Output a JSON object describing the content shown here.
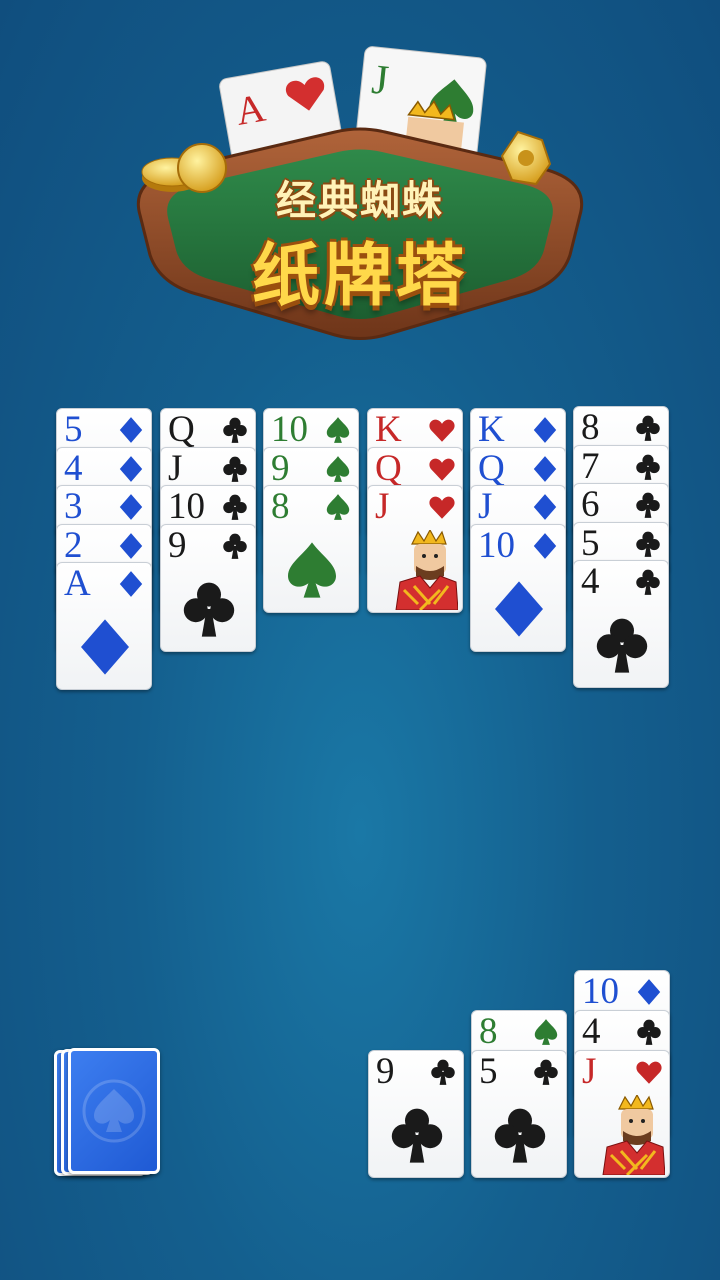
{
  "title": {
    "line1": "经典蜘蛛",
    "line2": "纸牌塔"
  },
  "logo_cards": [
    {
      "rank": "A",
      "suit": "heart"
    },
    {
      "rank": "J",
      "suit": "spade"
    }
  ],
  "colors": {
    "blue": "#1f4fd1",
    "black": "#1a1a1a",
    "green": "#2e7d32",
    "red": "#c62828",
    "table": "#145f8e"
  },
  "tableau": [
    {
      "cards": [
        {
          "rank": "5",
          "suit": "diamond"
        },
        {
          "rank": "4",
          "suit": "diamond"
        },
        {
          "rank": "3",
          "suit": "diamond"
        },
        {
          "rank": "2",
          "suit": "diamond"
        },
        {
          "rank": "A",
          "suit": "diamond"
        }
      ]
    },
    {
      "cards": [
        {
          "rank": "Q",
          "suit": "club"
        },
        {
          "rank": "J",
          "suit": "club"
        },
        {
          "rank": "10",
          "suit": "club"
        },
        {
          "rank": "9",
          "suit": "club"
        }
      ]
    },
    {
      "cards": [
        {
          "rank": "10",
          "suit": "spade"
        },
        {
          "rank": "9",
          "suit": "spade"
        },
        {
          "rank": "8",
          "suit": "spade"
        }
      ]
    },
    {
      "cards": [
        {
          "rank": "K",
          "suit": "heart"
        },
        {
          "rank": "Q",
          "suit": "heart"
        },
        {
          "rank": "J",
          "suit": "heart"
        }
      ]
    },
    {
      "cards": [
        {
          "rank": "K",
          "suit": "diamond"
        },
        {
          "rank": "Q",
          "suit": "diamond"
        },
        {
          "rank": "J",
          "suit": "diamond"
        },
        {
          "rank": "10",
          "suit": "diamond"
        }
      ]
    },
    {
      "cards": [
        {
          "rank": "8",
          "suit": "club"
        },
        {
          "rank": "7",
          "suit": "club"
        },
        {
          "rank": "6",
          "suit": "club"
        },
        {
          "rank": "5",
          "suit": "club"
        },
        {
          "rank": "4",
          "suit": "club"
        }
      ]
    }
  ],
  "bottom_piles": [
    {
      "cards": [
        {
          "rank": "9",
          "suit": "club"
        }
      ]
    },
    {
      "cards": [
        {
          "rank": "8",
          "suit": "spade"
        },
        {
          "rank": "5",
          "suit": "club"
        }
      ]
    },
    {
      "cards": [
        {
          "rank": "10",
          "suit": "diamond"
        },
        {
          "rank": "4",
          "suit": "club"
        },
        {
          "rank": "J",
          "suit": "heart"
        }
      ]
    }
  ],
  "stock": {
    "count": 3,
    "back_icon": "spade-icon"
  }
}
